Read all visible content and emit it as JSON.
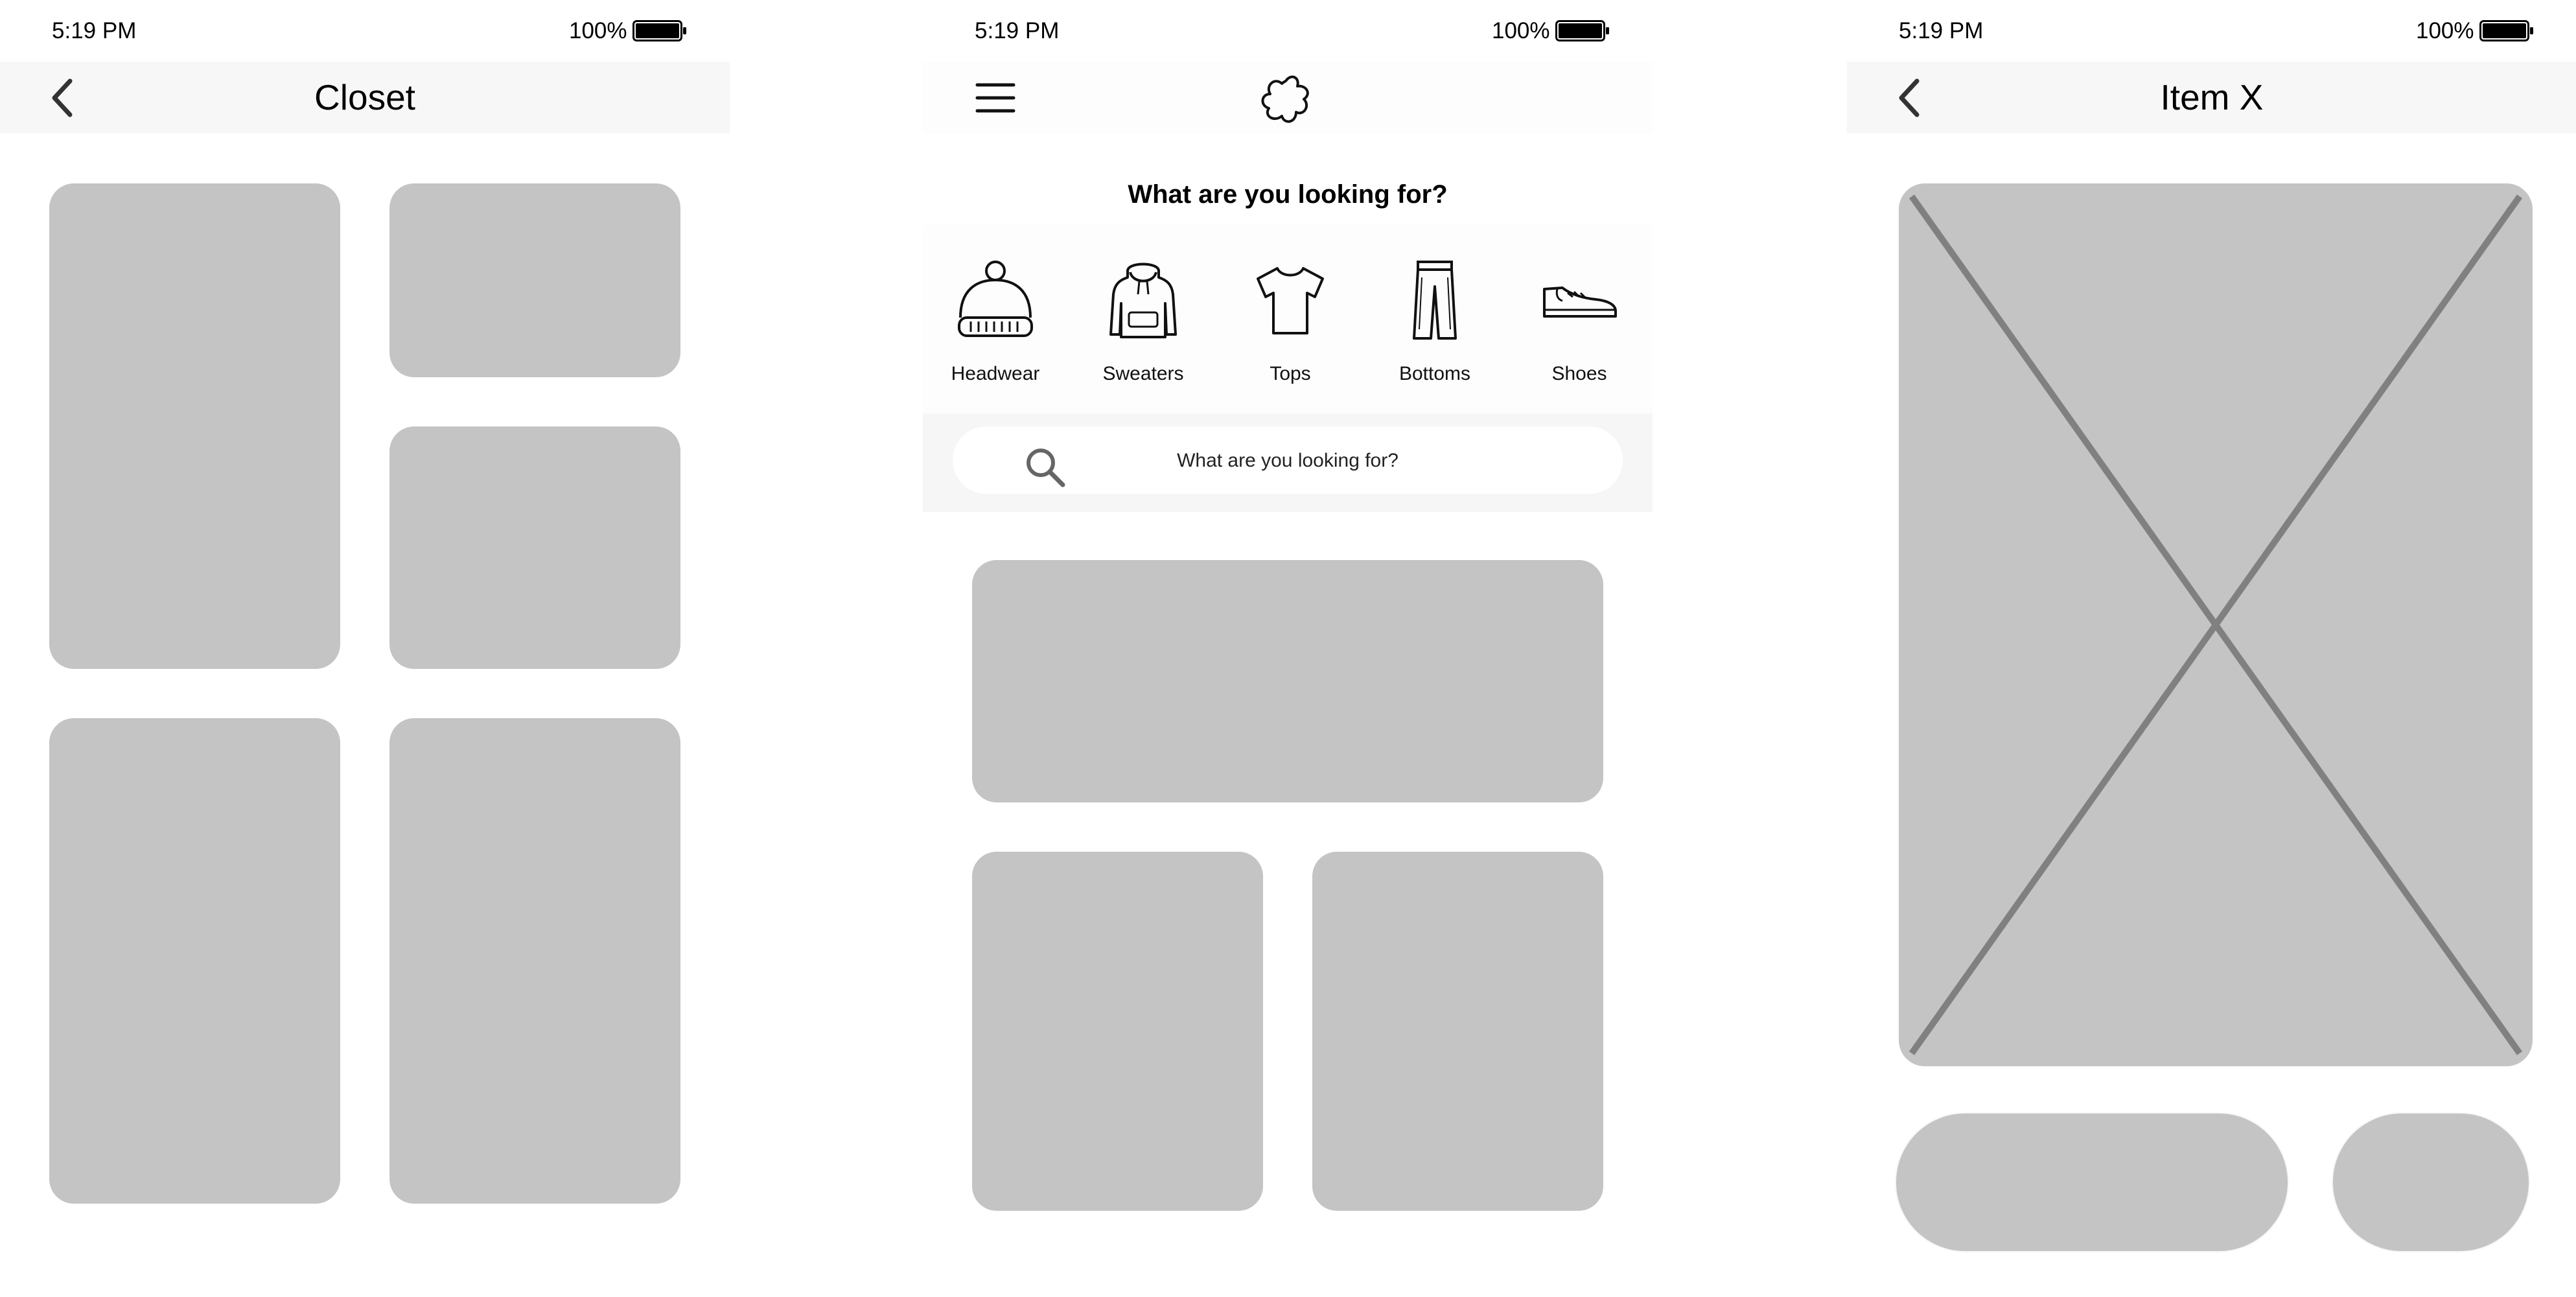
{
  "status_bar": {
    "time": "5:19 PM",
    "battery": "100%"
  },
  "closet": {
    "title": "Closet"
  },
  "home": {
    "question": "What are you looking for?",
    "categories": [
      {
        "label": "Headwear",
        "icon": "beanie-icon"
      },
      {
        "label": "Sweaters",
        "icon": "hoodie-icon"
      },
      {
        "label": "Tops",
        "icon": "tshirt-icon"
      },
      {
        "label": "Bottoms",
        "icon": "pants-icon"
      },
      {
        "label": "Shoes",
        "icon": "sneaker-icon"
      }
    ],
    "search": {
      "placeholder": "What are you looking for?"
    }
  },
  "item": {
    "title": "Item X"
  },
  "colors": {
    "tile": "#c4c4c4",
    "nav_bar": "#f7f7f7",
    "search_band": "#f6f6f6",
    "placeholder_cross": "#808080"
  }
}
